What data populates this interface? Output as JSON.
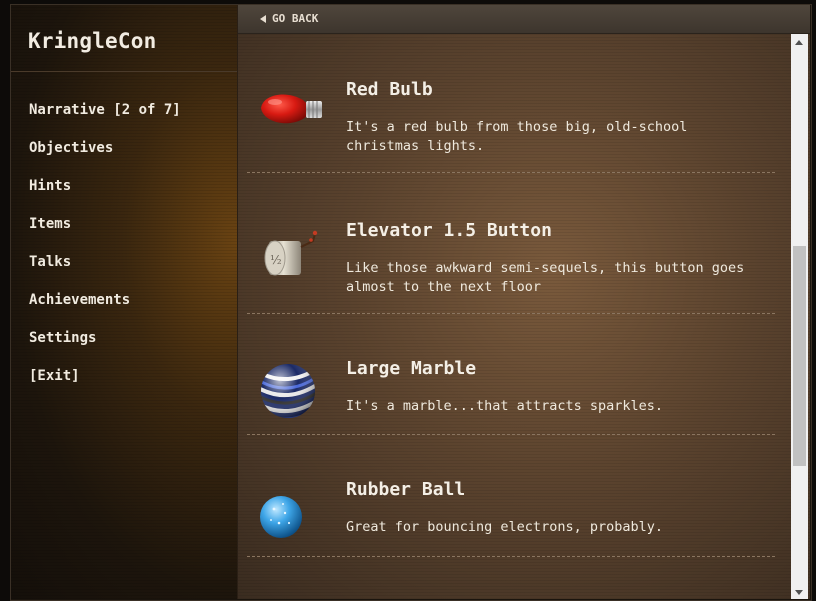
{
  "app": {
    "title": "KringleCon"
  },
  "sidebar": {
    "items": [
      {
        "label": "Narrative [2 of 7]"
      },
      {
        "label": "Objectives"
      },
      {
        "label": "Hints"
      },
      {
        "label": "Items"
      },
      {
        "label": "Talks"
      },
      {
        "label": "Achievements"
      },
      {
        "label": "Settings"
      },
      {
        "label": "[Exit]"
      }
    ]
  },
  "topbar": {
    "back_label": "GO BACK"
  },
  "items": [
    {
      "name": "Red Bulb",
      "description": "It's a red bulb from those big, old-school christmas lights.",
      "icon": "red-bulb-icon"
    },
    {
      "name": "Elevator 1.5 Button",
      "description": "Like those awkward semi-sequels, this button goes almost to the next floor",
      "icon": "elevator-button-icon"
    },
    {
      "name": "Large Marble",
      "description": "It's a marble...that attracts sparkles.",
      "icon": "marble-icon"
    },
    {
      "name": "Rubber Ball",
      "description": "Great for bouncing electrons, probably.",
      "icon": "rubber-ball-icon"
    }
  ],
  "colors": {
    "text": "#f1ebe0",
    "divider": "#8a7560",
    "accent_glow": "#6a4312"
  }
}
